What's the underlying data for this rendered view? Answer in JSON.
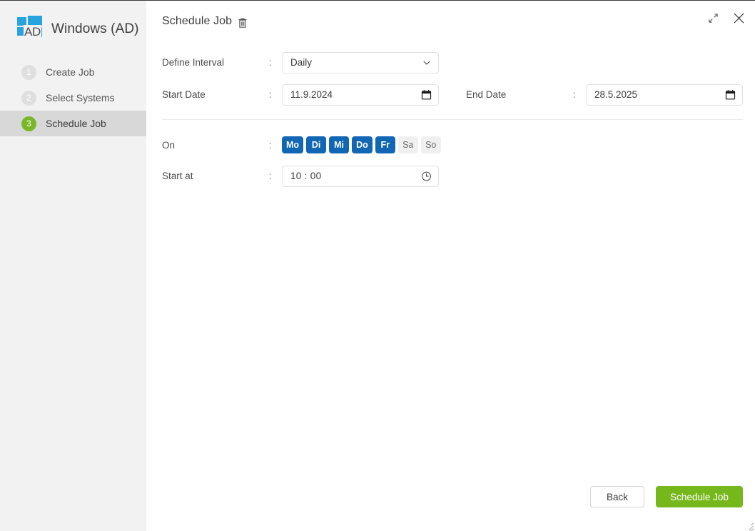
{
  "sidebar": {
    "brand": {
      "title": "Windows (AD)",
      "logo_overlay_text": "AD",
      "logo_color": "#28a3df"
    },
    "steps": [
      {
        "number": "1",
        "label": "Create Job",
        "active": false
      },
      {
        "number": "2",
        "label": "Select Systems",
        "active": false
      },
      {
        "number": "3",
        "label": "Schedule Job",
        "active": true
      }
    ]
  },
  "panel": {
    "title": "Schedule Job",
    "delete_icon": "trash-icon",
    "window_controls": {
      "expand_icon": "expand-icon",
      "close_icon": "close-icon"
    }
  },
  "form": {
    "define_interval": {
      "label": "Define Interval",
      "separator": ":",
      "value": "Daily",
      "icon": "chevron-down-icon",
      "options": [
        "Daily"
      ]
    },
    "start_date": {
      "label": "Start Date",
      "separator": ":",
      "value": "11.9.2024",
      "icon": "calendar-icon"
    },
    "end_date": {
      "label": "End Date",
      "separator": ":",
      "value": "28.5.2025",
      "icon": "calendar-icon"
    },
    "on_days": {
      "label": "On",
      "separator": ":",
      "days": [
        {
          "label": "Mo",
          "selected": true
        },
        {
          "label": "Di",
          "selected": true
        },
        {
          "label": "Mi",
          "selected": true
        },
        {
          "label": "Do",
          "selected": true
        },
        {
          "label": "Fr",
          "selected": true
        },
        {
          "label": "Sa",
          "selected": false
        },
        {
          "label": "So",
          "selected": false
        }
      ],
      "selected_color": "#1267b5",
      "unselected_color": "#f0f0f0"
    },
    "start_at": {
      "label": "Start at",
      "separator": ":",
      "value": "10 : 00",
      "icon": "clock-icon"
    }
  },
  "footer": {
    "back_label": "Back",
    "submit_label": "Schedule Job",
    "submit_color": "#76b81c"
  }
}
